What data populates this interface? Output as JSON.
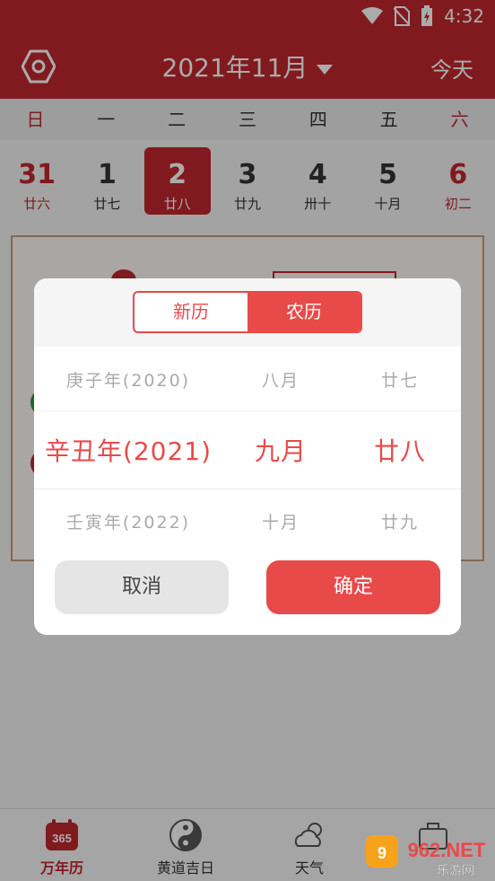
{
  "status_bar": {
    "time": "4:32"
  },
  "header": {
    "month_title": "2021年11月",
    "today_label": "今天"
  },
  "weekdays": [
    "日",
    "一",
    "二",
    "三",
    "四",
    "五",
    "六"
  ],
  "week_days": [
    {
      "num": "31",
      "lunar": "廿六"
    },
    {
      "num": "1",
      "lunar": "廿七"
    },
    {
      "num": "2",
      "lunar": "廿八"
    },
    {
      "num": "3",
      "lunar": "廿九"
    },
    {
      "num": "4",
      "lunar": "卅十"
    },
    {
      "num": "5",
      "lunar": "十月"
    },
    {
      "num": "6",
      "lunar": "初二"
    }
  ],
  "dialog": {
    "tab_solar": "新历",
    "tab_lunar": "农历",
    "rows": [
      {
        "year": "庚子年(2020)",
        "month": "八月",
        "day": "廿七"
      },
      {
        "year": "辛丑年(2021)",
        "month": "九月",
        "day": "廿八"
      },
      {
        "year": "壬寅年(2022)",
        "month": "十月",
        "day": "廿九"
      }
    ],
    "cancel_label": "取消",
    "confirm_label": "确定"
  },
  "bottom_nav": {
    "items": [
      {
        "label": "万年历",
        "badge": "365"
      },
      {
        "label": "黄道吉日"
      },
      {
        "label": "天气"
      },
      {
        "label": ""
      }
    ]
  },
  "watermark": {
    "text": "962.NET",
    "subtext": "乐游网"
  },
  "colors": {
    "primary": "#c1272d",
    "accent": "#e84a4a"
  }
}
